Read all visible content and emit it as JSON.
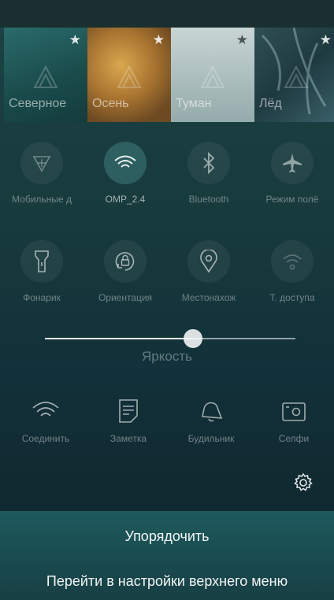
{
  "ambiences": [
    {
      "label": "Северное",
      "star": "★"
    },
    {
      "label": "Осень",
      "star": "★"
    },
    {
      "label": "Туман",
      "star": "★"
    },
    {
      "label": "Лёд",
      "star": "★"
    }
  ],
  "toggles_row1": [
    {
      "label": "Мобильные д",
      "icon": "mobile-data-icon",
      "active": false
    },
    {
      "label": "OMP_2.4",
      "icon": "wifi-icon",
      "active": true
    },
    {
      "label": "Bluetooth",
      "icon": "bluetooth-icon",
      "active": false
    },
    {
      "label": "Режим полё",
      "icon": "airplane-icon",
      "active": false
    }
  ],
  "toggles_row2": [
    {
      "label": "Фонарик",
      "icon": "flashlight-icon",
      "active": false
    },
    {
      "label": "Ориентация",
      "icon": "orientation-lock-icon",
      "active": false
    },
    {
      "label": "Местонахож",
      "icon": "location-icon",
      "active": false
    },
    {
      "label": "Т. доступа",
      "icon": "hotspot-icon",
      "active": false
    }
  ],
  "brightness": {
    "label": "Яркость",
    "value": 0.59
  },
  "shortcuts": [
    {
      "label": "Соединить",
      "icon": "wifi-connect-icon"
    },
    {
      "label": "Заметка",
      "icon": "note-icon"
    },
    {
      "label": "Будильник",
      "icon": "alarm-bell-icon"
    },
    {
      "label": "Селфи",
      "icon": "selfie-camera-icon"
    }
  ],
  "menu": {
    "arrange": "Упорядочить",
    "settings": "Перейти в настройки верхнего меню"
  },
  "colors": {
    "accent": "#6cc8c8",
    "menu_bg": "#1d5a5d"
  }
}
